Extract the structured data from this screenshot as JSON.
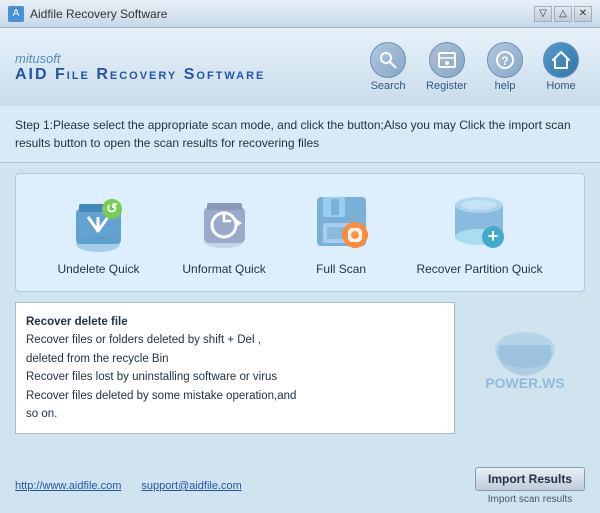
{
  "titleBar": {
    "title": "Aidfile Recovery Software",
    "controls": [
      "▽",
      "△",
      "✕"
    ]
  },
  "header": {
    "brand": "mitusoft",
    "product": "AID File Recovery Software",
    "toolbar": [
      {
        "id": "search",
        "label": "Search",
        "icon": "🔍"
      },
      {
        "id": "register",
        "label": "Register",
        "icon": "💾"
      },
      {
        "id": "help",
        "label": "help",
        "icon": "❓"
      },
      {
        "id": "home",
        "label": "Home",
        "icon": "🏠"
      }
    ]
  },
  "stepText": "Step 1:Please select the appropriate scan mode, and click the button;Also you may Click the import scan results button to open the scan results for recovering files",
  "scanOptions": [
    {
      "id": "undelete-quick",
      "label": "Undelete Quick",
      "icon": "🗑️"
    },
    {
      "id": "unformat-quick",
      "label": "Unformat Quick",
      "icon": "🔄"
    },
    {
      "id": "full-scan",
      "label": "Full Scan",
      "icon": "💾"
    },
    {
      "id": "recover-partition",
      "label": "Recover Partition Quick",
      "icon": "💿"
    }
  ],
  "description": {
    "lines": [
      "Recover delete file",
      "Recover files or folders deleted by shift + Del ,",
      "deleted from the recycle Bin",
      "Recover files lost by uninstalling software or virus",
      "Recover files deleted by some mistake operation,and",
      "so on."
    ]
  },
  "watermark": "POWER.WS",
  "bottomLinks": [
    {
      "label": "http://www.aidfile.com",
      "url": "#"
    },
    {
      "label": "support@aidfile.com",
      "url": "#"
    }
  ],
  "importButton": {
    "label": "Import  Results",
    "sublabel": "Import scan results"
  }
}
